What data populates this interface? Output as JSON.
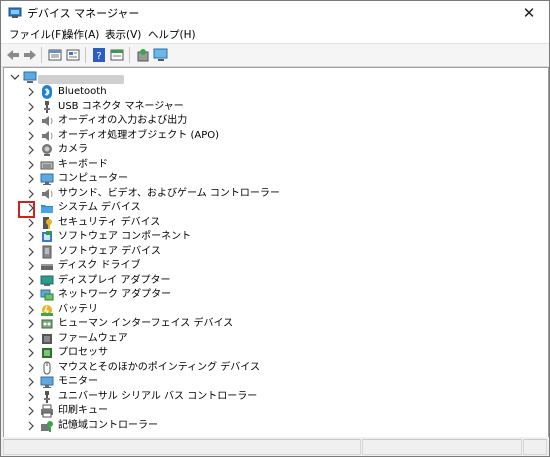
{
  "window": {
    "title": "デバイス マネージャー",
    "close_glyph": "✕"
  },
  "menu": {
    "file": "ファイル(F)",
    "action": "操作(A)",
    "view": "表示(V)",
    "help": "ヘルプ(H)"
  },
  "tree": {
    "computer_name": "",
    "devices": [
      {
        "label": "Bluetooth",
        "icon": "bluetooth-icon"
      },
      {
        "label": "USB コネクタ マネージャー",
        "icon": "usb-icon"
      },
      {
        "label": "オーディオの入力および出力",
        "icon": "speaker-icon"
      },
      {
        "label": "オーディオ処理オブジェクト (APO)",
        "icon": "speaker-icon"
      },
      {
        "label": "カメラ",
        "icon": "camera-icon"
      },
      {
        "label": "キーボード",
        "icon": "keyboard-icon"
      },
      {
        "label": "コンピューター",
        "icon": "monitor-icon"
      },
      {
        "label": "サウンド、ビデオ、およびゲーム コントローラー",
        "icon": "speaker-icon"
      },
      {
        "label": "システム デバイス",
        "icon": "folder-icon"
      },
      {
        "label": "セキュリティ デバイス",
        "icon": "security-icon"
      },
      {
        "label": "ソフトウェア コンポーネント",
        "icon": "component-icon"
      },
      {
        "label": "ソフトウェア デバイス",
        "icon": "software-device-icon"
      },
      {
        "label": "ディスク ドライブ",
        "icon": "disk-icon"
      },
      {
        "label": "ディスプレイ アダプター",
        "icon": "display-icon"
      },
      {
        "label": "ネットワーク アダプター",
        "icon": "network-icon"
      },
      {
        "label": "バッテリ",
        "icon": "battery-icon"
      },
      {
        "label": "ヒューマン インターフェイス デバイス",
        "icon": "hid-icon"
      },
      {
        "label": "ファームウェア",
        "icon": "firmware-icon"
      },
      {
        "label": "プロセッサ",
        "icon": "processor-icon"
      },
      {
        "label": "マウスとそのほかのポインティング デバイス",
        "icon": "mouse-icon"
      },
      {
        "label": "モニター",
        "icon": "monitor-icon"
      },
      {
        "label": "ユニバーサル シリアル バス コントローラー",
        "icon": "usb-icon"
      },
      {
        "label": "印刷キュー",
        "icon": "printer-icon"
      },
      {
        "label": "記憶域コントローラー",
        "icon": "storage-icon"
      }
    ]
  },
  "colors": {
    "highlight": "#d21f1f",
    "accent": "#1e7fd6"
  }
}
